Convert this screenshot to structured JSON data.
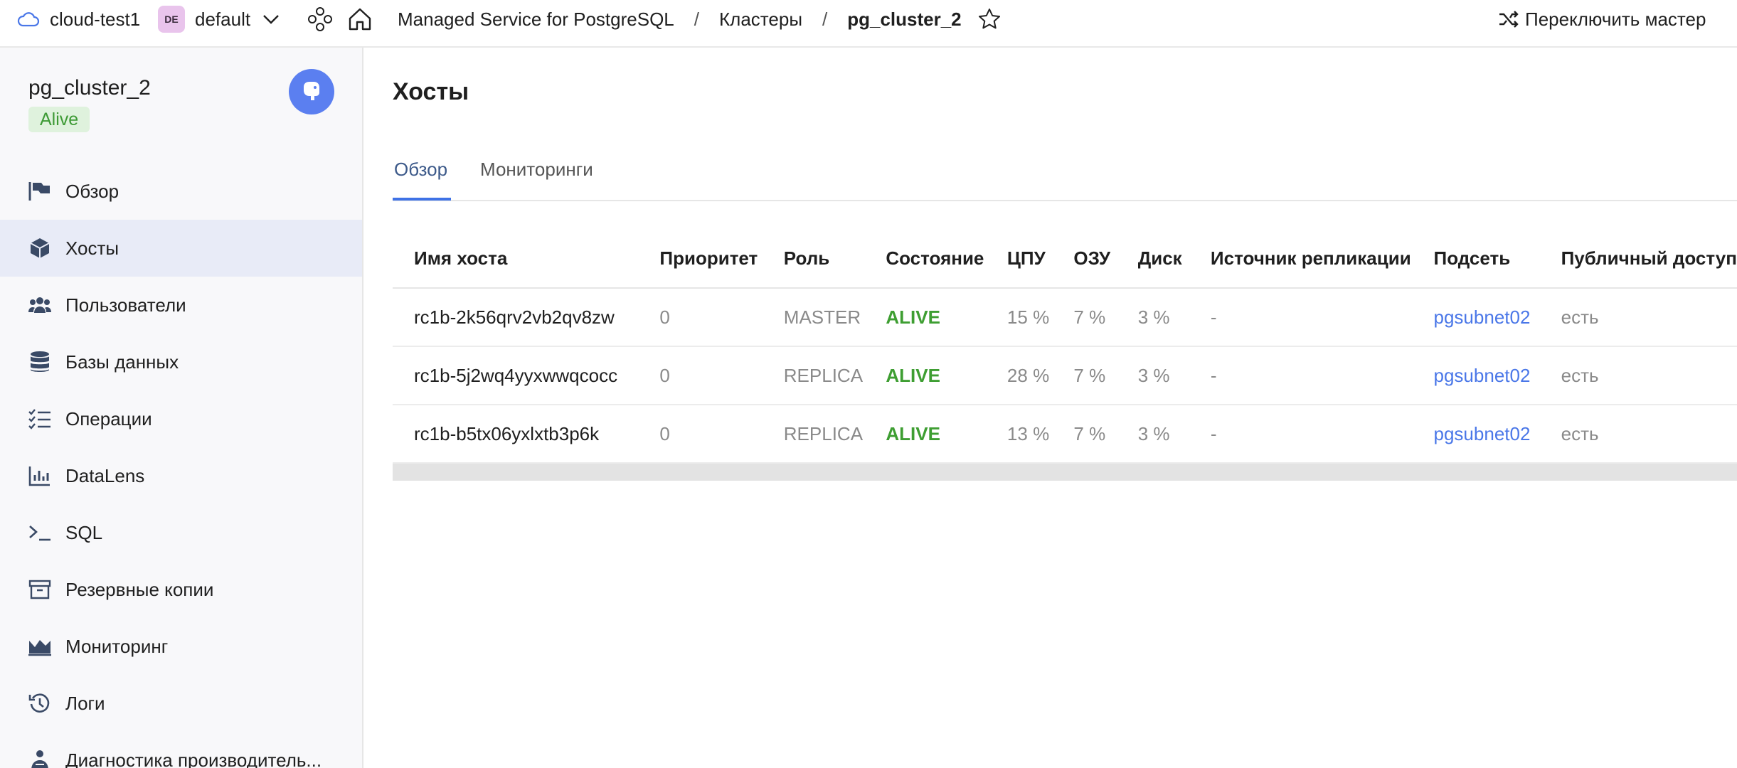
{
  "topbar": {
    "cloud_name": "cloud-test1",
    "folder_badge": "DE",
    "folder_name": "default",
    "breadcrumbs": [
      "Managed Service for PostgreSQL",
      "Кластеры",
      "pg_cluster_2"
    ],
    "separator": "/",
    "switch_master_label": "Переключить мастер"
  },
  "sidebar": {
    "cluster_name": "pg_cluster_2",
    "status": "Alive",
    "items": [
      {
        "label": "Обзор",
        "icon": "flag-icon"
      },
      {
        "label": "Хосты",
        "icon": "cube-icon",
        "active": true
      },
      {
        "label": "Пользователи",
        "icon": "users-icon"
      },
      {
        "label": "Базы данных",
        "icon": "database-icon"
      },
      {
        "label": "Операции",
        "icon": "checklist-icon"
      },
      {
        "label": "DataLens",
        "icon": "bar-chart-icon"
      },
      {
        "label": "SQL",
        "icon": "terminal-icon"
      },
      {
        "label": "Резервные копии",
        "icon": "archive-icon"
      },
      {
        "label": "Мониторинг",
        "icon": "area-chart-icon"
      },
      {
        "label": "Логи",
        "icon": "history-icon"
      },
      {
        "label": "Диагностика производитель...",
        "icon": "diagnostics-icon"
      }
    ]
  },
  "main": {
    "title": "Хосты",
    "tabs": [
      "Обзор",
      "Мониторинги"
    ],
    "table": {
      "columns": [
        "Имя хоста",
        "Приоритет",
        "Роль",
        "Состояние",
        "ЦПУ",
        "ОЗУ",
        "Диск",
        "Источник репликации",
        "Подсеть",
        "Публичный доступ"
      ],
      "rows": [
        [
          "rc1b-2k56qrv2vb2qv8zw",
          "0",
          "MASTER",
          "ALIVE",
          "15 %",
          "7 %",
          "3 %",
          "-",
          "pgsubnet02",
          "есть"
        ],
        [
          "rc1b-5j2wq4yyxwwqcocc",
          "0",
          "REPLICA",
          "ALIVE",
          "28 %",
          "7 %",
          "3 %",
          "-",
          "pgsubnet02",
          "есть"
        ],
        [
          "rc1b-b5tx06yxlxtb3p6k",
          "0",
          "REPLICA",
          "ALIVE",
          "13 %",
          "7 %",
          "3 %",
          "-",
          "pgsubnet02",
          "есть"
        ]
      ]
    }
  },
  "colors": {
    "accent": "#3f72e6",
    "status_ok": "#3e9e32",
    "link": "#4a77e8",
    "active_nav_bg": "#e8ebf7"
  }
}
